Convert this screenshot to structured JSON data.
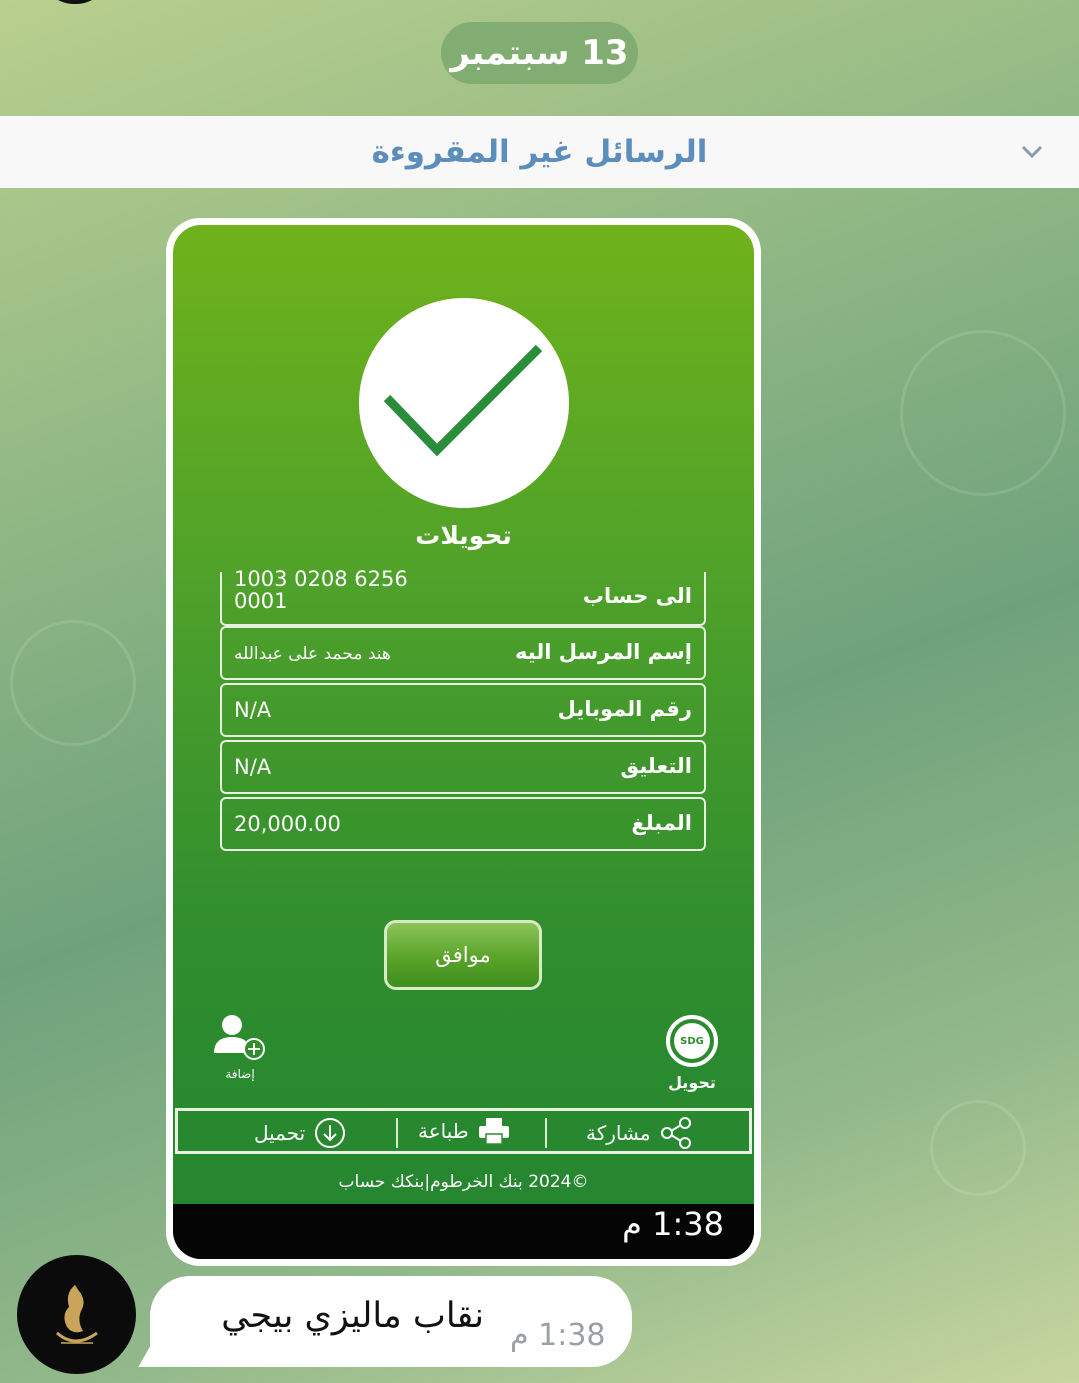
{
  "date_separator": "13 سبتمبر",
  "unread_banner": "الرسائل غير المقروءة",
  "receipt": {
    "title": "تحويلات",
    "rows": [
      {
        "label": "الى حساب",
        "value": "1003 0208 6256 0001"
      },
      {
        "label": "إسم المرسل اليه",
        "value": "هند محمد على عبدالله"
      },
      {
        "label": "رقم الموبايل",
        "value": "N/A"
      },
      {
        "label": "التعليق",
        "value": "N/A"
      },
      {
        "label": "المبلغ",
        "value": "20,000.00"
      }
    ],
    "ok_button": "موافق",
    "add_label": "إضافة",
    "transfer_label": "تحويل",
    "sdg_badge": "SDG",
    "actions": {
      "download": "تحميل",
      "print": "طباعة",
      "share": "مشاركة"
    },
    "footer": "©2024 بنك الخرطوم|بنكك حساب"
  },
  "image_time": "1:38 م",
  "text_message": {
    "text": "نقاب ماليزي بيجي",
    "time": "1:38 م"
  },
  "colors": {
    "accent": "#5b8ebc",
    "receipt_green": "#3a972c"
  }
}
